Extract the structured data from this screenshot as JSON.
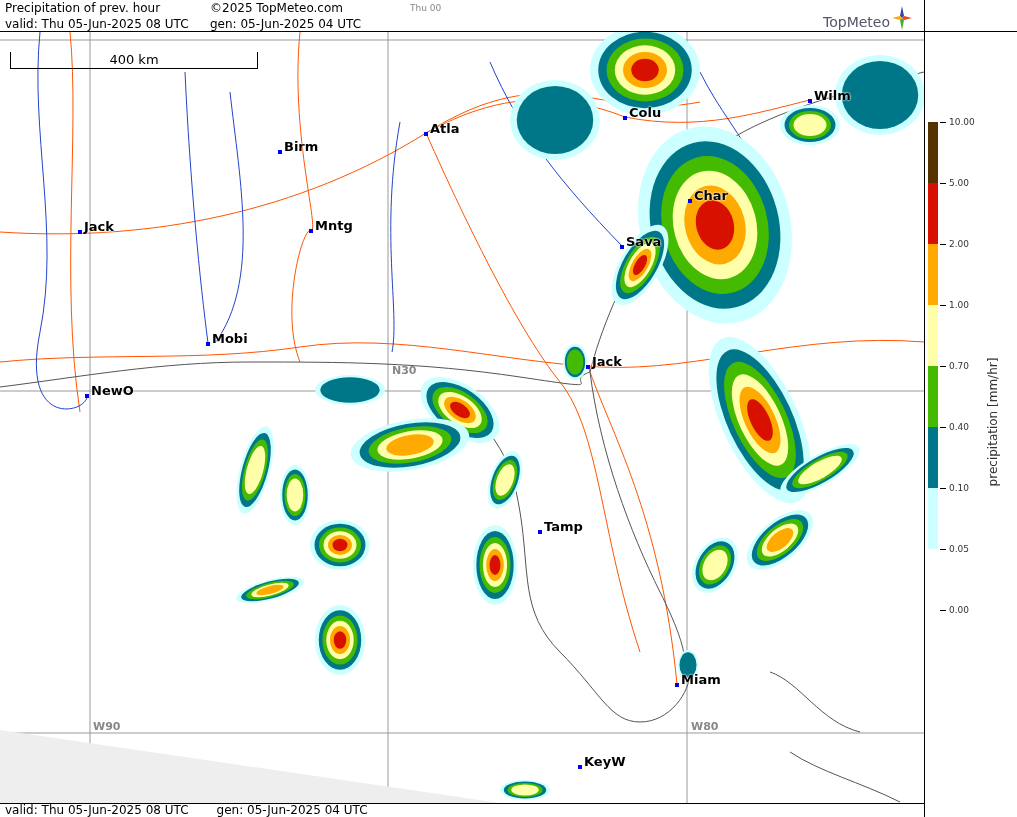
{
  "header": {
    "title": "Precipitation of prev. hour",
    "copyright": "©2025 TopMeteo.com",
    "run": "Thu 00",
    "valid": "valid:  Thu  05-Jun-2025  08 UTC",
    "gen": "gen: 05-Jun-2025 04 UTC"
  },
  "logo": {
    "text": "TopMeteo"
  },
  "scale_bar": {
    "label": "400 km"
  },
  "cities": [
    {
      "name": "Colu"
    },
    {
      "name": "Wilm"
    },
    {
      "name": "Atla"
    },
    {
      "name": "Birm"
    },
    {
      "name": "Char"
    },
    {
      "name": "Jack"
    },
    {
      "name": "Mntg"
    },
    {
      "name": "Sava"
    },
    {
      "name": "Mobi"
    },
    {
      "name": "Jack"
    },
    {
      "name": "NewO"
    },
    {
      "name": "Tamp"
    },
    {
      "name": "Miam"
    },
    {
      "name": "KeyW"
    }
  ],
  "grid_labels": [
    "N30",
    "W90",
    "W80"
  ],
  "legend": {
    "title": "precipitation  [mm/hr]",
    "items": [
      {
        "label": "10.00",
        "color": "#553300"
      },
      {
        "label": "5.00",
        "color": "#d81000"
      },
      {
        "label": "2.00",
        "color": "#ffaa00"
      },
      {
        "label": "1.00",
        "color": "#ffffaa"
      },
      {
        "label": "0.70",
        "color": "#44bb00"
      },
      {
        "label": "0.40",
        "color": "#007788"
      },
      {
        "label": "0.10",
        "color": "#ccffff"
      },
      {
        "label": "0.05"
      },
      {
        "label": "0.00"
      }
    ]
  },
  "footer": {
    "valid": "valid:  Thu  05-Jun-2025  08 UTC",
    "gen": "gen: 05-Jun-2025 04 UTC"
  }
}
